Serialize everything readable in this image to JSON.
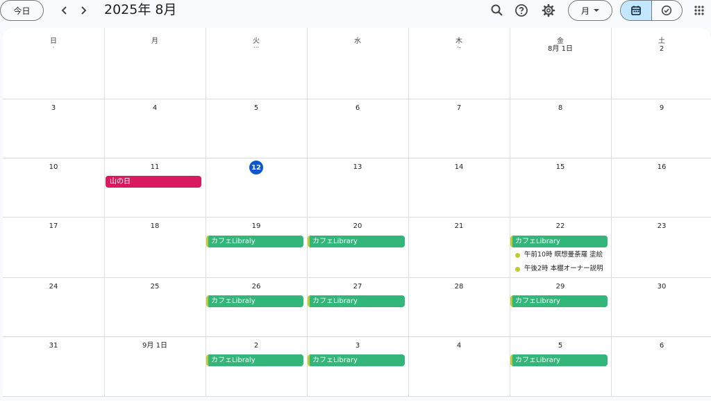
{
  "header": {
    "today_label": "今日",
    "month_title": "2025年 8月",
    "view_label": "月",
    "icons": [
      "chevron-left-icon",
      "chevron-right-icon",
      "search-icon",
      "help-icon",
      "gear-icon",
      "calendar-icon",
      "task-icon",
      "apps-icon"
    ]
  },
  "weekdays": [
    "日",
    "月",
    "火",
    "水",
    "木",
    "金",
    "土"
  ],
  "weekday_subs": [
    "·",
    "",
    "···",
    "",
    "·-",
    "",
    ""
  ],
  "weeks": [
    [
      "",
      "",
      "",
      "",
      "",
      "8月 1日",
      "2"
    ],
    [
      "3",
      "4",
      "5",
      "6",
      "7",
      "8",
      "9"
    ],
    [
      "10",
      "11",
      "12",
      "13",
      "14",
      "15",
      "16"
    ],
    [
      "17",
      "18",
      "19",
      "20",
      "21",
      "22",
      "23"
    ],
    [
      "24",
      "25",
      "26",
      "27",
      "28",
      "29",
      "30"
    ],
    [
      "31",
      "9月 1日",
      "2",
      "3",
      "4",
      "5",
      "6"
    ]
  ],
  "today": "12",
  "events": {
    "holiday": "山の日",
    "w4_tue": "カフェLibraly",
    "w4_wed": "カフェLibrary",
    "w4_fri": "カフェLibrary",
    "w4_fri_item1": "午前10時 瞑想曼荼羅 塗絵",
    "w4_fri_item2": "午後2時 本棚オーナー説明",
    "w5_tue": "カフェLibraly",
    "w5_wed": "カフェLibrary",
    "w5_fri": "カフェLibrary",
    "w6_tue": "カフェLibraly",
    "w6_wed": "カフェLibrary",
    "w6_fri": "カフェLibrary"
  },
  "colors": {
    "accent": "#0b57d0",
    "event_green": "#33b679",
    "event_red": "#d81b60",
    "event_stripe": "#c0ca33",
    "active_view": "#c2e7ff"
  }
}
